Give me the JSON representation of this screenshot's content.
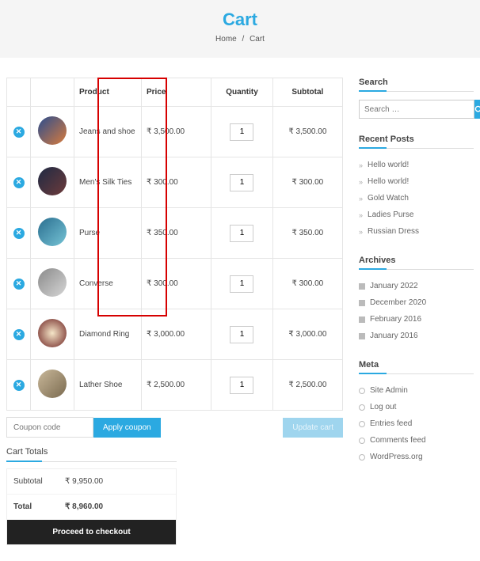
{
  "hero": {
    "title": "Cart",
    "crumb_home": "Home",
    "crumb_sep": "/",
    "crumb_current": "Cart"
  },
  "thead": {
    "product": "Product",
    "price": "Price",
    "qty": "Quantity",
    "subtotal": "Subtotal"
  },
  "rows": [
    {
      "name": "Jeans and shoe",
      "price": "₹ 3,500.00",
      "qty": "1",
      "subtotal": "₹ 3,500.00",
      "img": "linear-gradient(135deg,#2a4d8f,#d97b3c)"
    },
    {
      "name": "Men's Silk Ties",
      "price": "₹ 300.00",
      "qty": "1",
      "subtotal": "₹ 300.00",
      "img": "linear-gradient(135deg,#1e2a44,#6e3b3b)"
    },
    {
      "name": "Purse",
      "price": "₹ 350.00",
      "qty": "1",
      "subtotal": "₹ 350.00",
      "img": "linear-gradient(135deg,#2a6e8f,#76c4d6)"
    },
    {
      "name": "Converse",
      "price": "₹ 300.00",
      "qty": "1",
      "subtotal": "₹ 300.00",
      "img": "linear-gradient(135deg,#8a8a8a,#d6d6d6)"
    },
    {
      "name": "Diamond Ring",
      "price": "₹ 3,000.00",
      "qty": "1",
      "subtotal": "₹ 3,000.00",
      "img": "radial-gradient(circle,#f5e6c8,#6b1f1f)"
    },
    {
      "name": "Lather Shoe",
      "price": "₹ 2,500.00",
      "qty": "1",
      "subtotal": "₹ 2,500.00",
      "img": "linear-gradient(135deg,#c9b89a,#7a6a4f)"
    }
  ],
  "coupon": {
    "placeholder": "Coupon code",
    "apply": "Apply coupon",
    "update": "Update cart"
  },
  "totals": {
    "title": "Cart Totals",
    "subtotal_l": "Subtotal",
    "subtotal_v": "₹ 9,950.00",
    "total_l": "Total",
    "total_v": "₹ 8,960.00",
    "checkout": "Proceed to checkout"
  },
  "sidebar": {
    "search_title": "Search",
    "search_ph": "Search …",
    "recent_title": "Recent Posts",
    "recent": [
      "Hello world!",
      "Hello world!",
      "Gold Watch",
      "Ladies Purse",
      "Russian Dress"
    ],
    "arch_title": "Archives",
    "arch": [
      "January 2022",
      "December 2020",
      "February 2016",
      "January 2016"
    ],
    "meta_title": "Meta",
    "meta": [
      "Site Admin",
      "Log out",
      "Entries feed",
      "Comments feed",
      "WordPress.org"
    ]
  }
}
